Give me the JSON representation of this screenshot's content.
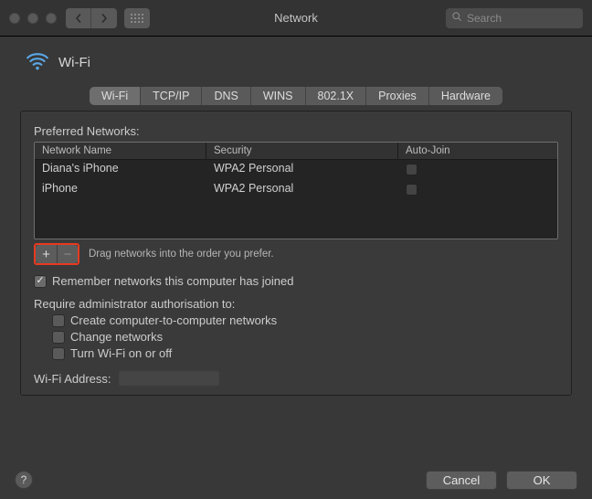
{
  "titlebar": {
    "title": "Network",
    "search_placeholder": "Search"
  },
  "header": {
    "title": "Wi-Fi"
  },
  "tabs": [
    {
      "label": "Wi-Fi",
      "active": true
    },
    {
      "label": "TCP/IP",
      "active": false
    },
    {
      "label": "DNS",
      "active": false
    },
    {
      "label": "WINS",
      "active": false
    },
    {
      "label": "802.1X",
      "active": false
    },
    {
      "label": "Proxies",
      "active": false
    },
    {
      "label": "Hardware",
      "active": false
    }
  ],
  "panel": {
    "section_label": "Preferred Networks:",
    "table": {
      "columns": [
        "Network Name",
        "Security",
        "Auto-Join"
      ],
      "rows": [
        {
          "name": "Diana's iPhone",
          "security": "WPA2 Personal",
          "auto_join": false
        },
        {
          "name": "iPhone",
          "security": "WPA2 Personal",
          "auto_join": false
        }
      ]
    },
    "drag_hint": "Drag networks into the order you prefer.",
    "remember_label": "Remember networks this computer has joined",
    "remember_checked": true,
    "auth_label": "Require administrator authorisation to:",
    "auth_options": [
      {
        "label": "Create computer-to-computer networks",
        "checked": false
      },
      {
        "label": "Change networks",
        "checked": false
      },
      {
        "label": "Turn Wi-Fi on or off",
        "checked": false
      }
    ],
    "wifi_address_label": "Wi-Fi Address:"
  },
  "buttons": {
    "cancel": "Cancel",
    "ok": "OK"
  }
}
